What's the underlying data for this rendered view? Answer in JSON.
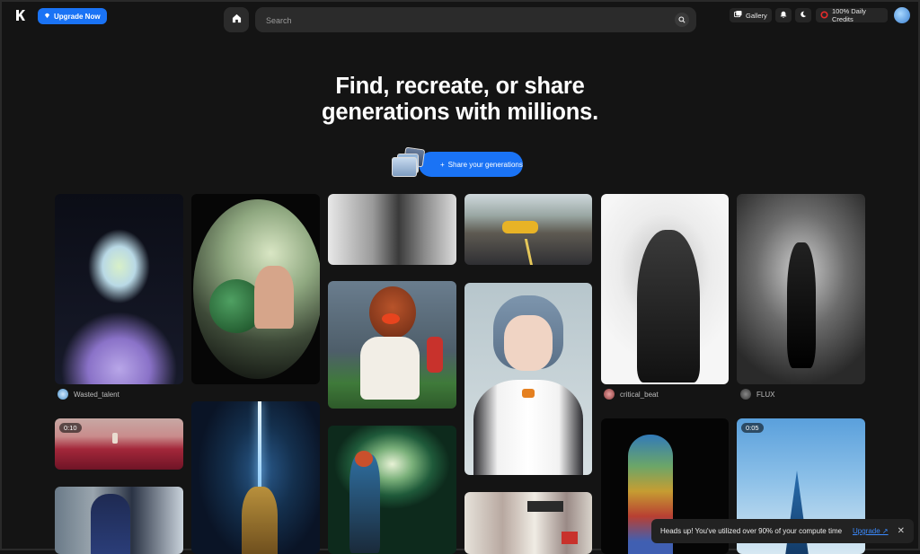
{
  "topbar": {
    "upgrade_label": "Upgrade Now",
    "search_placeholder": "Search",
    "gallery_label": "Gallery",
    "credits_label": "100% Daily Credits"
  },
  "hero": {
    "title_line1": "Find, recreate, or share",
    "title_line2": "generations with millions.",
    "share_label": "Share your generations"
  },
  "cards": [
    {
      "creator": "Wasted_talent"
    },
    {
      "creator": "critical_beat"
    },
    {
      "creator": "FLUX"
    },
    {
      "duration": "0:10"
    },
    {
      "duration": "0:05"
    }
  ],
  "toast": {
    "message": "Heads up! You've utilized over 90% of your compute time",
    "upgrade_label": "Upgrade ↗"
  },
  "colors": {
    "accent": "#1a73f5",
    "background": "#141414"
  }
}
